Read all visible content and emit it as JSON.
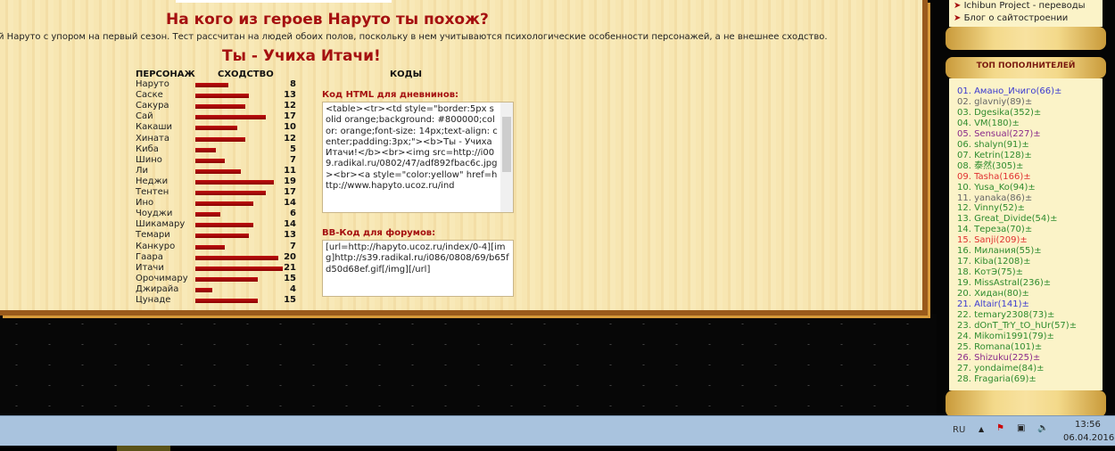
{
  "main": {
    "title": "На кого из героев Наруто ты похож?",
    "description": "й Наруто с упором на первый сезон. Тест рассчитан на людей обоих полов, поскольку в нем учитываются психологические особенности персонажей, а не внешнее сходство.",
    "result": "Ты - Учиха Итачи!",
    "col_character": "ПЕРСОНАЖ",
    "col_similarity": "СХОДСТВО",
    "col_codes": "КОДЫ",
    "rows": [
      {
        "name": "Наруто",
        "value": 8
      },
      {
        "name": "Саске",
        "value": 13
      },
      {
        "name": "Сакура",
        "value": 12
      },
      {
        "name": "Сай",
        "value": 17
      },
      {
        "name": "Какаши",
        "value": 10
      },
      {
        "name": "Хината",
        "value": 12
      },
      {
        "name": "Киба",
        "value": 5
      },
      {
        "name": "Шино",
        "value": 7
      },
      {
        "name": "Ли",
        "value": 11
      },
      {
        "name": "Неджи",
        "value": 19
      },
      {
        "name": "Тентен",
        "value": 17
      },
      {
        "name": "Ино",
        "value": 14
      },
      {
        "name": "Чоуджи",
        "value": 6
      },
      {
        "name": "Шикамару",
        "value": 14
      },
      {
        "name": "Темари",
        "value": 13
      },
      {
        "name": "Канкуро",
        "value": 7
      },
      {
        "name": "Гаара",
        "value": 20
      },
      {
        "name": "Итачи",
        "value": 21
      },
      {
        "name": "Орочимару",
        "value": 15
      },
      {
        "name": "Джирайа",
        "value": 4
      },
      {
        "name": "Цунаде",
        "value": 15
      }
    ],
    "html_label": "Код HTML для дневнинов:",
    "html_code": "<table><tr><td style=\"border:5px solid orange;background: #800000;color: orange;font-size: 14px;text-align: center;padding:3px;\"><b>Ты - Учиха Итачи!</b><br><img src=http://i009.radikal.ru/0802/47/adf892fbac6c.jpg><br><a style=\"color:yellow\" href=http://www.hapyto.ucoz.ru/ind",
    "bb_label": "BB-Код для форумов:",
    "bb_code": "[url=http://hapyto.ucoz.ru/index/0-4][img]http://s39.radikal.ru/i086/0808/69/b65fd50d68ef.gif[/img][/url]"
  },
  "sidebar": {
    "links": [
      "Ichibun Project - переводы",
      "Блог о сайтостроении"
    ],
    "top_title": "ТОП ПОПОЛНИТЕЛЕЙ",
    "top": [
      {
        "t": "01. Амано_Ичиго(66)±",
        "c": "#3a3ad0"
      },
      {
        "t": "02. glavniy(89)±",
        "c": "#666666"
      },
      {
        "t": "03. Dgesika(352)±",
        "c": "#2e8b2e"
      },
      {
        "t": "04. VM(180)±",
        "c": "#2e8b2e"
      },
      {
        "t": "05. Sensual(227)±",
        "c": "#8a2a8a"
      },
      {
        "t": "06. shalyn(91)±",
        "c": "#2e8b2e"
      },
      {
        "t": "07. Ketrin(128)±",
        "c": "#2e8b2e"
      },
      {
        "t": "08. 泰然(305)±",
        "c": "#2e8b2e"
      },
      {
        "t": "09. Tasha(166)±",
        "c": "#e03030"
      },
      {
        "t": "10. Yusa_Ko(94)±",
        "c": "#2e8b2e"
      },
      {
        "t": "11. yanaka(86)±",
        "c": "#666666"
      },
      {
        "t": "12. Vinny(52)±",
        "c": "#2e8b2e"
      },
      {
        "t": "13. Great_Divide(54)±",
        "c": "#2e8b2e"
      },
      {
        "t": "14. Тереза(70)±",
        "c": "#2e8b2e"
      },
      {
        "t": "15. Sanji(209)±",
        "c": "#e03030"
      },
      {
        "t": "16. Милания(55)±",
        "c": "#2e8b2e"
      },
      {
        "t": "17. Kiba(1208)±",
        "c": "#2e8b2e"
      },
      {
        "t": "18. КотЭ(75)±",
        "c": "#2e8b2e"
      },
      {
        "t": "19. MissAstral(236)±",
        "c": "#2e8b2e"
      },
      {
        "t": "20. Хидан(80)±",
        "c": "#2e8b2e"
      },
      {
        "t": "21. Altair(141)±",
        "c": "#3a3ad0"
      },
      {
        "t": "22. temary2308(73)±",
        "c": "#2e8b2e"
      },
      {
        "t": "23. dOnT_TrY_tO_hUr(57)±",
        "c": "#2e8b2e"
      },
      {
        "t": "24. Mikomi1991(79)±",
        "c": "#2e8b2e"
      },
      {
        "t": "25. Romana(101)±",
        "c": "#2e8b2e"
      },
      {
        "t": "26. Shizuku(225)±",
        "c": "#8a2a8a"
      },
      {
        "t": "27. yondaime(84)±",
        "c": "#2e8b2e"
      },
      {
        "t": "28. Fragaria(69)±",
        "c": "#2e8b2e"
      }
    ]
  },
  "taskbar": {
    "lang": "RU",
    "time": "13:56",
    "date": "06.04.2016"
  }
}
